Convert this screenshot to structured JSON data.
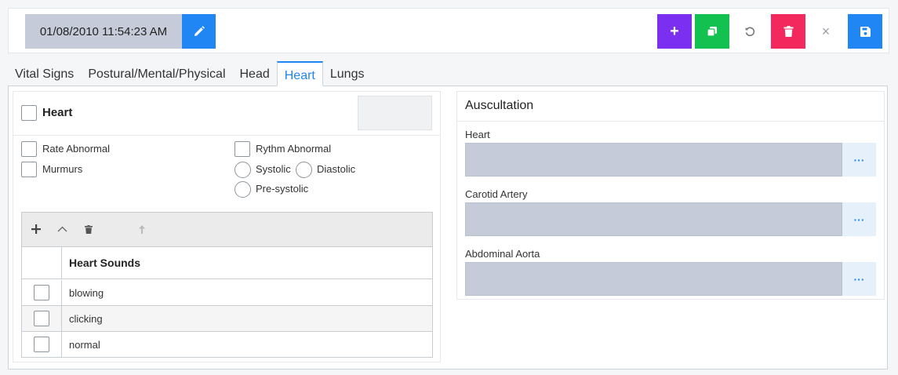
{
  "header": {
    "datetime": "01/08/2010 11:54:23 AM",
    "buttons": {
      "add": "+",
      "close": "×"
    }
  },
  "tabs": [
    {
      "label": "Vital Signs",
      "active": false
    },
    {
      "label": "Postural/Mental/Physical",
      "active": false
    },
    {
      "label": "Head",
      "active": false
    },
    {
      "label": "Heart",
      "active": true
    },
    {
      "label": "Lungs",
      "active": false
    }
  ],
  "heart_panel": {
    "title": "Heart",
    "options": {
      "rate_abnormal": "Rate Abnormal",
      "rythm_abnormal": "Rythm Abnormal",
      "murmurs": "Murmurs",
      "systolic": "Systolic",
      "diastolic": "Diastolic",
      "pre_systolic": "Pre-systolic"
    },
    "grid": {
      "column_header": "Heart Sounds",
      "rows": [
        "blowing",
        "clicking",
        "normal"
      ]
    }
  },
  "auscultation": {
    "title": "Auscultation",
    "fields": [
      {
        "label": "Heart",
        "value": ""
      },
      {
        "label": "Carotid Artery",
        "value": ""
      },
      {
        "label": "Abdominal Aorta",
        "value": ""
      }
    ],
    "more_label": "···"
  },
  "colors": {
    "accent": "#1f86f4",
    "add": "#7b2ff0",
    "copy": "#12c14f",
    "delete": "#f3285d",
    "field_bg": "#c5cbd9"
  },
  "icons": [
    "pencil-icon",
    "plus-icon",
    "copy-icon",
    "undo-icon",
    "trash-icon",
    "close-icon",
    "save-icon",
    "chevron-up-icon",
    "arrow-up-icon",
    "ellipsis-icon"
  ]
}
